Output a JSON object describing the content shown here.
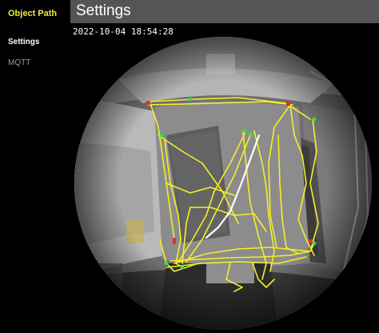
{
  "sidebar": {
    "title": "Object Path",
    "items": [
      {
        "label": "Settings",
        "active": true
      },
      {
        "label": "MQTT",
        "active": false
      }
    ]
  },
  "header": {
    "title": "Settings"
  },
  "viewer": {
    "timestamp": "2022-10-04 18:54:28",
    "icons": [
      "fisheye-camera-image",
      "object-path-overlay"
    ]
  },
  "colors": {
    "accent": "#f0ea3a",
    "header_bg": "#555555",
    "background": "#000000",
    "path_primary": "#f5ee2a",
    "path_recent": "#ffffff",
    "marker_start": "#3ddc3d",
    "marker_end": "#e03030"
  }
}
